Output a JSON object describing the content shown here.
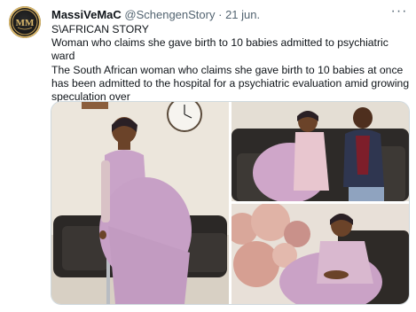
{
  "tweet": {
    "author": {
      "display_name": "MassiVeMaC",
      "handle": "@SchengenStory",
      "avatar_initials": "MM"
    },
    "separator": "·",
    "date": "21 jun.",
    "text_lines": [
      "S\\AFRICAN STORY",
      "Woman who claims she gave birth to 10 babies admitted to psychiatric ward",
      "The South African woman who claims she gave birth to 10 babies at once",
      "has been admitted to the hospital for a psychiatric evaluation amid growing",
      "speculation over"
    ],
    "more_icon": "ellipsis-icon"
  },
  "media": {
    "photos": [
      {
        "id": "main",
        "icon": "photo-woman-standing"
      },
      {
        "id": "top",
        "icon": "photo-couple-sofa"
      },
      {
        "id": "bottom",
        "icon": "photo-woman-balloons"
      }
    ]
  },
  "colors": {
    "text_primary": "#0f1419",
    "text_secondary": "#536471",
    "border": "#cfd9de",
    "dress_lilac": "#c9a3c8",
    "balloon_rose": "#d9a79a"
  }
}
